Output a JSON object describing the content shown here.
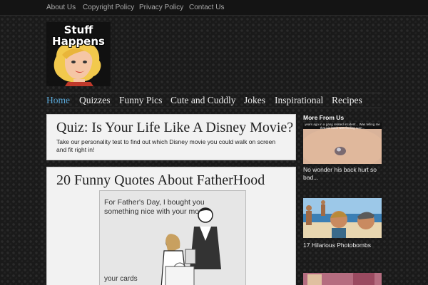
{
  "top_nav": [
    "About Us",
    "Copyright Policy",
    "Privacy Policy",
    "Contact Us"
  ],
  "logo": {
    "line1": "Stuff",
    "line2": "Happens"
  },
  "main_nav": [
    "Home",
    "Quizzes",
    "Funny Pics",
    "Cute and Cuddly",
    "Jokes",
    "Inspirational",
    "Recipes"
  ],
  "quiz": {
    "title": "Quiz: Is Your Life Like A Disney Movie?",
    "description": "Take our personality test to find out which Disney movie you could walk on screen and fit right in!"
  },
  "post": {
    "title": "20 Funny Quotes About FatherHood",
    "ecard_text": "For Father's Day, I bought you something nice with your money.",
    "ecard_brand": "your cards"
  },
  "sidebar": {
    "heading": "More From Us",
    "items": [
      {
        "caption": "No wonder his back hurt so bad...",
        "thumb_text": "years ago in a gang related incident... Was telling me that his back was feeling sore..."
      },
      {
        "caption": "17 Hilarious Photobombs"
      }
    ]
  }
}
